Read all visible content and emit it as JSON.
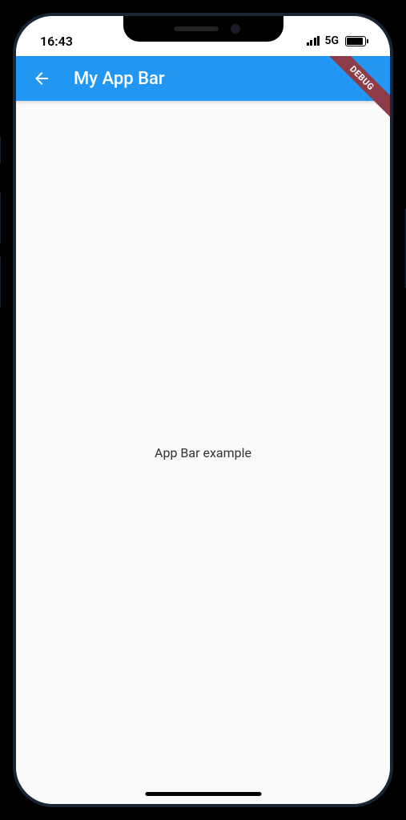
{
  "statusBar": {
    "time": "16:43",
    "network": "5G"
  },
  "appBar": {
    "title": "My App Bar"
  },
  "debugBanner": {
    "label": "DEBUG"
  },
  "content": {
    "text": "App Bar example"
  }
}
